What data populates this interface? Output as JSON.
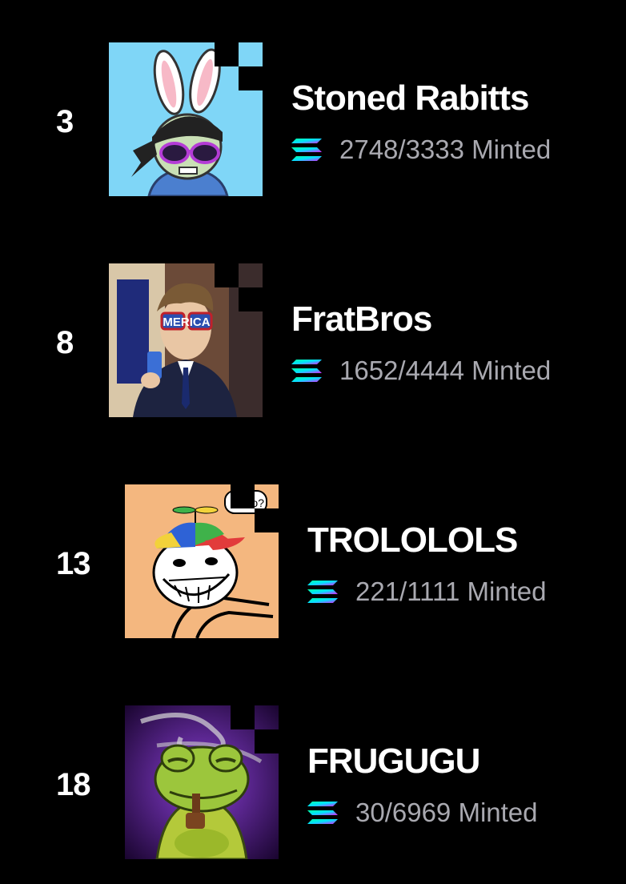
{
  "colors": {
    "background": "#000000",
    "text": "#ffffff",
    "muted": "#a9a9b0",
    "solana_gradient": [
      "#00ffa3",
      "#03e1ff",
      "#dc1fff"
    ]
  },
  "collections": [
    {
      "rank": "3",
      "name": "Stoned Rabitts",
      "minted": "2748/3333 Minted",
      "icon": "solana-icon",
      "image": "rabbit-avatar"
    },
    {
      "rank": "8",
      "name": "FratBros",
      "minted": "1652/4444 Minted",
      "icon": "solana-icon",
      "image": "fratbro-avatar",
      "image_text": "MERICA"
    },
    {
      "rank": "13",
      "name": "TROLOLOLS",
      "minted": "221/1111 Minted",
      "icon": "solana-icon",
      "image": "trollface-avatar",
      "image_text": "bro?"
    },
    {
      "rank": "18",
      "name": "FRUGUGU",
      "minted": "30/6969 Minted",
      "icon": "solana-icon",
      "image": "frog-avatar"
    }
  ]
}
